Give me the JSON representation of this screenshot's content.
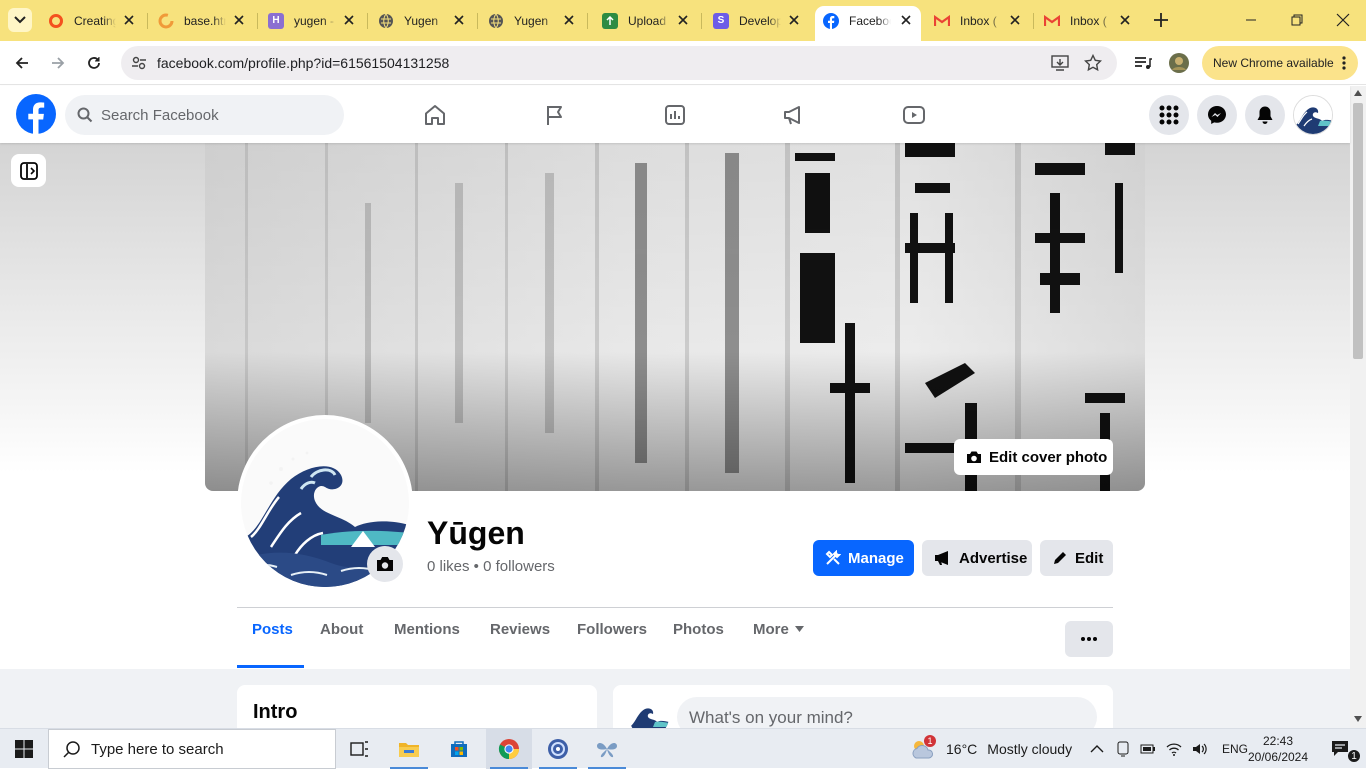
{
  "browser": {
    "tabs": [
      {
        "title": "Creating",
        "favicon": "ring-orange-icon",
        "color": "#f4511e"
      },
      {
        "title": "base.html",
        "favicon": "grammarly-g-icon",
        "color": "#f09a39"
      },
      {
        "title": "yugen -",
        "favicon": "h-logo-icon",
        "color": "#8b6fd1"
      },
      {
        "title": "Yugen",
        "favicon": "globe-icon",
        "color": "#555555"
      },
      {
        "title": "Yugen",
        "favicon": "globe-icon",
        "color": "#555555"
      },
      {
        "title": "Upload",
        "favicon": "upload-icon",
        "color": "#2e8b43"
      },
      {
        "title": "Develop",
        "favicon": "s-logo-icon",
        "color": "#6c5ce7"
      },
      {
        "title": "Facebook",
        "favicon": "facebook-icon",
        "color": "#0866ff",
        "active": true
      },
      {
        "title": "Inbox (",
        "favicon": "gmail-icon",
        "color": "#ea4335"
      },
      {
        "title": "Inbox (",
        "favicon": "gmail-icon",
        "color": "#ea4335"
      }
    ],
    "url": "facebook.com/profile.php?id=61561504131258",
    "update_label": "New Chrome available"
  },
  "fb": {
    "search_placeholder": "Search Facebook",
    "brand_color": "#0866ff"
  },
  "profile": {
    "name": "Yūgen",
    "stats": "0 likes • 0 followers",
    "edit_cover": "Edit cover photo",
    "manage": "Manage",
    "advertise": "Advertise",
    "edit": "Edit",
    "tabs": [
      "Posts",
      "About",
      "Mentions",
      "Reviews",
      "Followers",
      "Photos",
      "More"
    ],
    "intro_title": "Intro",
    "composer_placeholder": "What's on your mind?"
  },
  "taskbar": {
    "search_placeholder": "Type here to search",
    "weather_temp": "16°C",
    "weather_desc": "Mostly cloudy",
    "weather_badge": "1",
    "lang": "ENG",
    "time": "22:43",
    "date": "20/06/2024",
    "notif_count": "1"
  }
}
